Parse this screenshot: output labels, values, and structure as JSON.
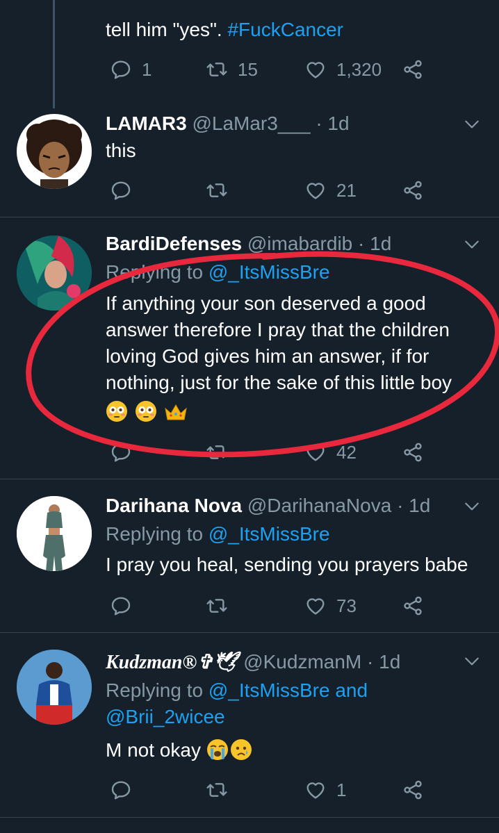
{
  "tweets": [
    {
      "text_pre": "tell him \"yes\". ",
      "hashtag": "#FuckCancer",
      "replies": "1",
      "retweets": "15",
      "likes": "1,320"
    },
    {
      "name": "LAMAR3",
      "handle": "@LaMar3___",
      "time": "· 1d",
      "text": "this",
      "replies": "",
      "retweets": "",
      "likes": "21"
    },
    {
      "name": "BardiDefenses",
      "handle": "@imabardib",
      "time": "· 1d",
      "replying_label": "Replying to ",
      "replying_to": "@_ItsMissBre",
      "text_lines": [
        "If anything your son deserved a good",
        "answer therefore I pray that the children",
        "loving God gives him an answer, if for",
        "nothing, just for the sake of this little boy"
      ],
      "emojis": [
        "flushed-face",
        "flushed-face",
        "crown"
      ],
      "likes": "42"
    },
    {
      "name": "Darihana Nova",
      "handle": "@DarihanaNova",
      "time": "· 1d",
      "replying_label": "Replying to ",
      "replying_to": "@_ItsMissBre",
      "text": "I pray you heal, sending you prayers babe",
      "likes": "73"
    },
    {
      "name": "Kudzman®✞🕊",
      "handle": "@KudzmanM",
      "time": "· 1d",
      "replying_label": "Replying to ",
      "replying_to": "@_ItsMissBre",
      "replying_and": " and",
      "replying_to_2": "@Brii_2wicee",
      "text": "M not okay",
      "emojis": [
        "loudly-crying-face",
        "sad-face"
      ],
      "likes": "1"
    }
  ],
  "icons": {
    "reply": "reply-icon",
    "retweet": "retweet-icon",
    "like": "heart-icon",
    "share": "share-icon",
    "more": "chevron-down-icon"
  },
  "colors": {
    "background": "#15202b",
    "link": "#1da1f2",
    "secondary": "#8899a6",
    "annotation": "#e8283c"
  }
}
